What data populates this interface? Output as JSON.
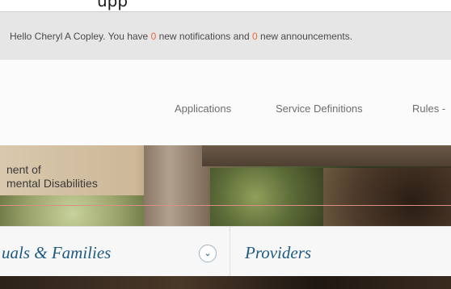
{
  "header_clip": "upp",
  "notification": {
    "prefix": "Hello Cheryl A Copley. You have ",
    "notifications_count": "0",
    "middle": " new notifications and ",
    "announcements_count": "0",
    "suffix": " new announcements."
  },
  "nav": {
    "items": [
      {
        "label": "Applications"
      },
      {
        "label": "Service Definitions"
      },
      {
        "label": "Rules -"
      }
    ]
  },
  "hero": {
    "line1": "nent of",
    "line2": "mental Disabilities"
  },
  "tabs": {
    "left_label": "uals & Families",
    "toggle_icon": "chevron-down-icon",
    "right_label": "Providers"
  },
  "colors": {
    "notify_count": "#e86a3a",
    "tab_text": "#1f5a80"
  }
}
